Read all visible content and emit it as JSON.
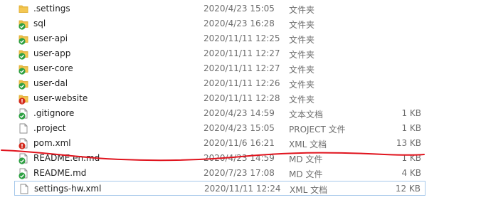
{
  "files": [
    {
      "name": ".settings",
      "date": "2020/4/23 15:05",
      "type": "文件夹",
      "size": "",
      "icon": "folder-icon",
      "badge": ""
    },
    {
      "name": "sql",
      "date": "2020/4/23 16:28",
      "type": "文件夹",
      "size": "",
      "icon": "folder-icon",
      "badge": "ok"
    },
    {
      "name": "user-api",
      "date": "2020/11/11 12:25",
      "type": "文件夹",
      "size": "",
      "icon": "folder-icon",
      "badge": "ok"
    },
    {
      "name": "user-app",
      "date": "2020/11/11 12:27",
      "type": "文件夹",
      "size": "",
      "icon": "folder-icon",
      "badge": "ok"
    },
    {
      "name": "user-core",
      "date": "2020/11/11 12:27",
      "type": "文件夹",
      "size": "",
      "icon": "folder-icon",
      "badge": "ok"
    },
    {
      "name": "user-dal",
      "date": "2020/11/11 12:26",
      "type": "文件夹",
      "size": "",
      "icon": "folder-icon",
      "badge": "ok"
    },
    {
      "name": "user-website",
      "date": "2020/11/11 12:28",
      "type": "文件夹",
      "size": "",
      "icon": "folder-icon",
      "badge": "error"
    },
    {
      "name": ".gitignore",
      "date": "2020/4/23 14:59",
      "type": "文本文档",
      "size": "1 KB",
      "icon": "file-icon",
      "badge": "ok"
    },
    {
      "name": ".project",
      "date": "2020/4/23 15:05",
      "type": "PROJECT 文件",
      "size": "1 KB",
      "icon": "file-icon",
      "badge": ""
    },
    {
      "name": "pom.xml",
      "date": "2020/11/6 16:21",
      "type": "XML 文档",
      "size": "13 KB",
      "icon": "file-icon",
      "badge": "error"
    },
    {
      "name": "README.en.md",
      "date": "2020/4/23 14:59",
      "type": "MD 文件",
      "size": "1 KB",
      "icon": "file-icon",
      "badge": "ok"
    },
    {
      "name": "README.md",
      "date": "2020/7/23 17:08",
      "type": "MD 文件",
      "size": "4 KB",
      "icon": "file-icon",
      "badge": "ok"
    },
    {
      "name": "settings-hw.xml",
      "date": "2020/11/11 12:24",
      "type": "XML 文档",
      "size": "12 KB",
      "icon": "file-icon",
      "badge": "",
      "selected": true
    }
  ],
  "colors": {
    "folder": "#f4c752",
    "folder_dark": "#dcaa2e",
    "ok_badge": "#2ea043",
    "error_badge": "#d32a1c",
    "annotation_line": "#e0141e",
    "selection_border": "#a6c8ea"
  }
}
